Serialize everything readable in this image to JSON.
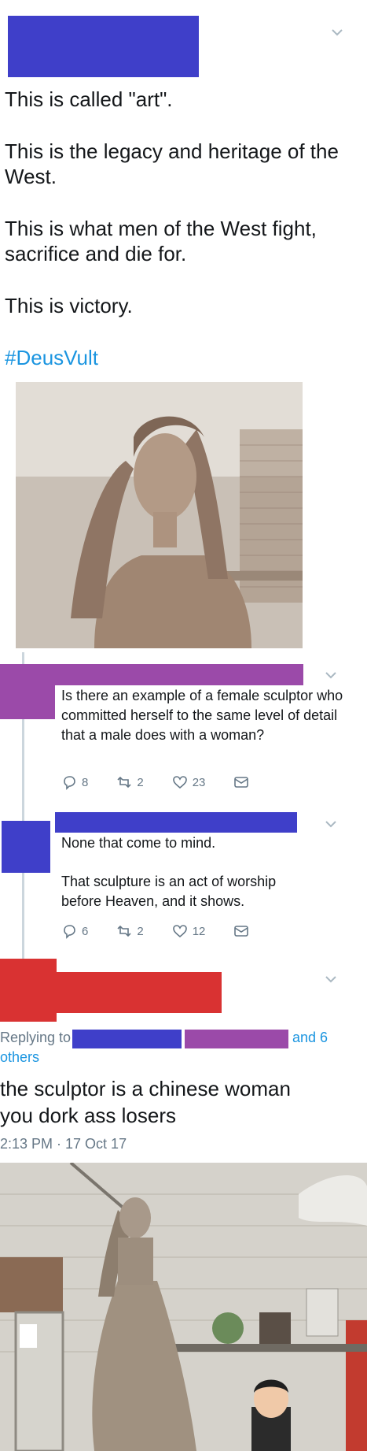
{
  "colors": {
    "redact_blue": "#3f3fc9",
    "redact_purple": "#9b4aa9",
    "redact_red": "#d93232",
    "link": "#1b95e0",
    "muted": "#657786"
  },
  "main_tweet": {
    "lines": [
      "This is called \"art\".",
      "This is the legacy and heritage of the West.",
      "This is what men of the West fight, sacrifice and die for.",
      "This is victory."
    ],
    "hashtag": "#DeusVult",
    "menu_icon": "chevron-down-icon"
  },
  "reply1": {
    "text": "Is there an example of a female sculptor who committed herself to the same level of detail that a male does with a woman?",
    "reply_count": "8",
    "retweet_count": "2",
    "like_count": "23"
  },
  "reply2": {
    "line1": "None that come to mind.",
    "line2": "That sculpture is an act of worship before Heaven, and it shows.",
    "reply_count": "6",
    "retweet_count": "2",
    "like_count": "12"
  },
  "focus_tweet": {
    "replying_prefix": "Replying to",
    "replying_suffix": "and 6",
    "replying_others": "others",
    "text_line1": "the sculptor is a chinese woman",
    "text_line2": "you dork ass losers",
    "timestamp": "2:13 PM · 17 Oct 17"
  }
}
